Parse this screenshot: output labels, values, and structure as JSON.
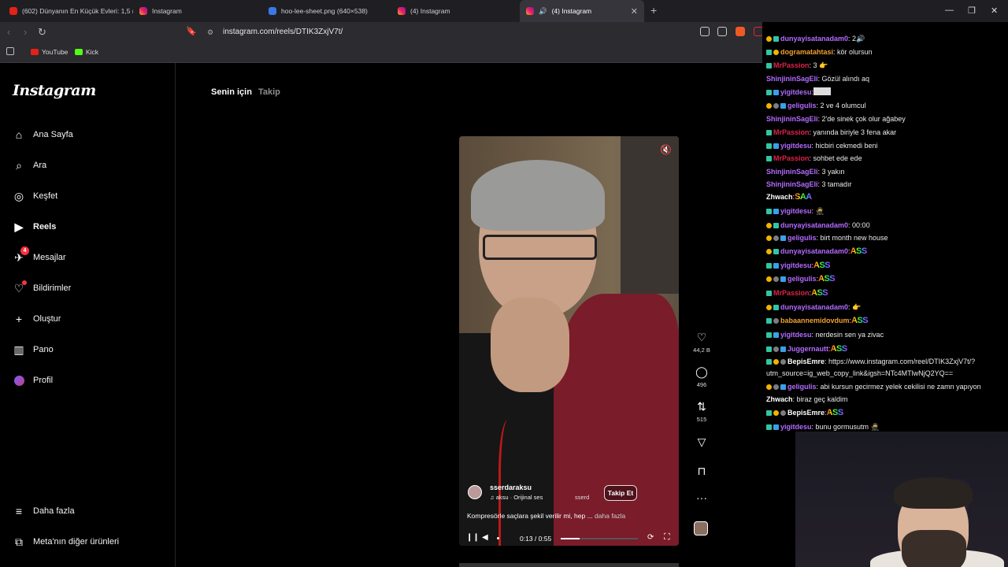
{
  "browser": {
    "tabs": [
      {
        "label": "(602) Dünyanın En Küçük Evleri: 1,5 m",
        "favicon": "youtube-icon"
      },
      {
        "label": "Instagram",
        "favicon": "instagram-icon"
      },
      {
        "label": "hoo-lee-sheet.png (640×538)",
        "favicon": "gif-icon"
      },
      {
        "label": "(4) Instagram",
        "favicon": "instagram-icon"
      },
      {
        "label": "(4) Instagram",
        "favicon": "instagram-icon",
        "active": true
      }
    ],
    "url": "instagram.com/reels/DTIK3ZxjV7t/",
    "bookmarks": [
      {
        "label": "YouTube"
      },
      {
        "label": "Kick"
      }
    ]
  },
  "instagram": {
    "logo": "Instagram",
    "nav": [
      {
        "label": "Ana Sayfa",
        "icon": "home-icon"
      },
      {
        "label": "Ara",
        "icon": "search-icon"
      },
      {
        "label": "Keşfet",
        "icon": "compass-icon"
      },
      {
        "label": "Reels",
        "icon": "reels-icon",
        "active": true
      },
      {
        "label": "Mesajlar",
        "icon": "messenger-icon",
        "badge": "4"
      },
      {
        "label": "Bildirimler",
        "icon": "heart-icon"
      },
      {
        "label": "Oluştur",
        "icon": "plus-icon"
      },
      {
        "label": "Pano",
        "icon": "dashboard-icon"
      },
      {
        "label": "Profil",
        "icon": "avatar-icon"
      }
    ],
    "nav_bottom": [
      {
        "label": "Daha fazla",
        "icon": "menu-icon"
      },
      {
        "label": "Meta'nın diğer ürünleri",
        "icon": "meta-apps-icon"
      }
    ],
    "feed_tabs": {
      "for_you": "Senin için",
      "following": "Takip"
    },
    "reel": {
      "author": "sserdaraksu",
      "audio": "aksu · Orijinal ses",
      "audio_tail": "sserd",
      "follow": "Takip Et",
      "caption": "Kompresörle saçlara şekil verilir mi, hep ...",
      "caption_more": "daha fazla",
      "time": "0:13 / 0:55",
      "progress": 0.24,
      "likes": "44,2 B",
      "comments": "496",
      "reposts": "515"
    }
  },
  "chat": {
    "messages": [
      {
        "user": "dunyayisatanadam0",
        "color": "#b36bff",
        "badges": [
          "vip",
          "mod"
        ],
        "text": ": 2🔊"
      },
      {
        "user": "dogramatahtasi",
        "color": "#f0a030",
        "badges": [
          "mod",
          "vip"
        ],
        "text": ": kör olursun"
      },
      {
        "user": "MrPassion",
        "color": "#e0234a",
        "badges": [
          "mod"
        ],
        "text": ": 3 👉"
      },
      {
        "user": "ShinjininSagEli",
        "color": "#b36bff",
        "badges": [],
        "text": ": Gözül alındı aq"
      },
      {
        "user": "yigitdesu",
        "color": "#b36bff",
        "badges": [
          "mod",
          "sub"
        ],
        "text": ":",
        "image": true
      },
      {
        "user": "geligulis",
        "color": "#b36bff",
        "badges": [
          "vip",
          "gift",
          "sub"
        ],
        "text": ": 2 ve 4 olumcul"
      },
      {
        "user": "ShinjininSagEli",
        "color": "#b36bff",
        "badges": [],
        "text": ": 2'de sinek çok olur ağabey"
      },
      {
        "user": "MrPassion",
        "color": "#e0234a",
        "badges": [
          "mod"
        ],
        "text": ": yanında biriyle 3 fena akar"
      },
      {
        "user": "yigitdesu",
        "color": "#b36bff",
        "badges": [
          "mod",
          "sub"
        ],
        "text": ": hicbiri cekmedi beni"
      },
      {
        "user": "MrPassion",
        "color": "#e0234a",
        "badges": [
          "mod"
        ],
        "text": ": sohbet ede ede"
      },
      {
        "user": "ShinjininSagEli",
        "color": "#b36bff",
        "badges": [],
        "text": ": 3 yakın"
      },
      {
        "user": "ShinjininSagEli",
        "color": "#b36bff",
        "badges": [],
        "text": ": 3 tamadır"
      },
      {
        "user": "Zhwach",
        "color": "#ffffff",
        "badges": [],
        "text": ":",
        "emote": "SAA"
      },
      {
        "user": "yigitdesu",
        "color": "#b36bff",
        "badges": [
          "mod",
          "sub"
        ],
        "text": ": 🥷"
      },
      {
        "user": "dunyayisatanadam0",
        "color": "#b36bff",
        "badges": [
          "vip",
          "mod"
        ],
        "text": ": 00:00"
      },
      {
        "user": "geligulis",
        "color": "#b36bff",
        "badges": [
          "vip",
          "gift",
          "sub"
        ],
        "text": ": birt month new house"
      },
      {
        "user": "dunyayisatanadam0",
        "color": "#b36bff",
        "badges": [
          "vip",
          "mod"
        ],
        "text": ":",
        "emote": "ASS"
      },
      {
        "user": "yigitdesu",
        "color": "#b36bff",
        "badges": [
          "mod",
          "sub"
        ],
        "text": ":",
        "emote": "ASS"
      },
      {
        "user": "geligulis",
        "color": "#b36bff",
        "badges": [
          "vip",
          "gift",
          "sub"
        ],
        "text": ":",
        "emote": "ASS"
      },
      {
        "user": "MrPassion",
        "color": "#e0234a",
        "badges": [
          "mod"
        ],
        "text": ":",
        "emote": "ASS"
      },
      {
        "user": "dunyayisatanadam0",
        "color": "#b36bff",
        "badges": [
          "vip",
          "mod"
        ],
        "text": ": 👉"
      },
      {
        "user": "babaannemidovdum",
        "color": "#f0a030",
        "badges": [
          "mod",
          "gift"
        ],
        "text": ":",
        "emote": "ASS"
      },
      {
        "user": "yigitdesu",
        "color": "#b36bff",
        "badges": [
          "mod",
          "sub"
        ],
        "text": ": nerdesin sen ya zivac"
      },
      {
        "user": "Juggernautt",
        "color": "#b36bff",
        "badges": [
          "mod",
          "gift",
          "sub"
        ],
        "text": ":",
        "emote": "ASS"
      },
      {
        "user": "BepisEmre",
        "color": "#ffffff",
        "badges": [
          "mod",
          "vip",
          "gift"
        ],
        "text": ": https://www.instagram.com/reel/DTIK3ZxjV7t/?"
      },
      {
        "user": "",
        "color": "#eaeaea",
        "badges": [],
        "text": "utm_source=ig_web_copy_link&igsh=NTc4MTlwNjQ2YQ=="
      },
      {
        "user": "geligulis",
        "color": "#b36bff",
        "badges": [
          "vip",
          "gift",
          "sub"
        ],
        "text": ": abi kursun gecirmez yelek cekilisi ne zamn yapıyon"
      },
      {
        "user": "Zhwach",
        "color": "#ffffff",
        "badges": [],
        "text": ": biraz geç kaldim"
      },
      {
        "user": "BepisEmre",
        "color": "#ffffff",
        "badges": [
          "mod",
          "vip",
          "gift"
        ],
        "text": ":",
        "emote": "ASS"
      },
      {
        "user": "yigitdesu",
        "color": "#b36bff",
        "badges": [
          "mod",
          "sub"
        ],
        "text": ": bunu gormusutm 🥷"
      }
    ]
  }
}
